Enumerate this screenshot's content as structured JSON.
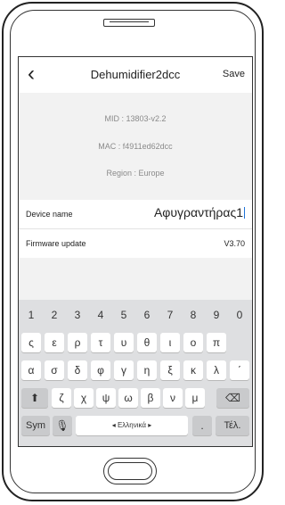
{
  "header": {
    "title": "Dehumidifier2dcc",
    "save_label": "Save",
    "back_icon": "chevron-left-icon"
  },
  "info": {
    "mid": "MID : 13803-v2.2",
    "mac": "MAC : f4911ed62dcc",
    "region": "Region : Europe"
  },
  "device_name": {
    "label": "Device name",
    "value": "Αφυγραντήρας1"
  },
  "firmware": {
    "label": "Firmware update",
    "value": "V3.70"
  },
  "keyboard": {
    "numbers": [
      "1",
      "2",
      "3",
      "4",
      "5",
      "6",
      "7",
      "8",
      "9",
      "0"
    ],
    "row1": [
      "ς",
      "ε",
      "ρ",
      "τ",
      "υ",
      "θ",
      "ι",
      "ο",
      "π"
    ],
    "row2": [
      "α",
      "σ",
      "δ",
      "φ",
      "γ",
      "η",
      "ξ",
      "κ",
      "λ",
      "΄"
    ],
    "row3": [
      "ζ",
      "χ",
      "ψ",
      "ω",
      "β",
      "ν",
      "μ"
    ],
    "sym_label": "Sym",
    "space_label": "◂ Ελληνικά ▸",
    "dot_label": ".",
    "done_label": "Τέλ."
  }
}
